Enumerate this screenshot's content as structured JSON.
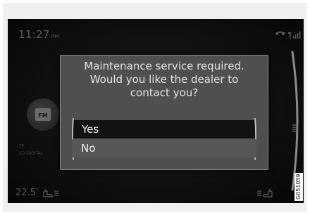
{
  "status_bar": {
    "time": "11:27",
    "ampm": "PM",
    "icons": [
      "phone-icon",
      "signal-icon"
    ]
  },
  "source": {
    "label": "FM",
    "line1": "TP",
    "line2": "CD DIGITAL"
  },
  "climate": {
    "left_temp": "22.5",
    "degree_symbol": "°"
  },
  "dialog": {
    "message_line1": "Maintenance service required.",
    "message_line2": "Would you like the dealer to",
    "message_line3": "contact you?",
    "options": [
      "Yes",
      "No"
    ],
    "selected": "Yes"
  },
  "figure_code": "G051059",
  "colors": {
    "screen_bg": "#070707",
    "dialog_bg": "#4f4f4f",
    "selected_option_bg": "#121212",
    "text": "#e4e4e4"
  }
}
